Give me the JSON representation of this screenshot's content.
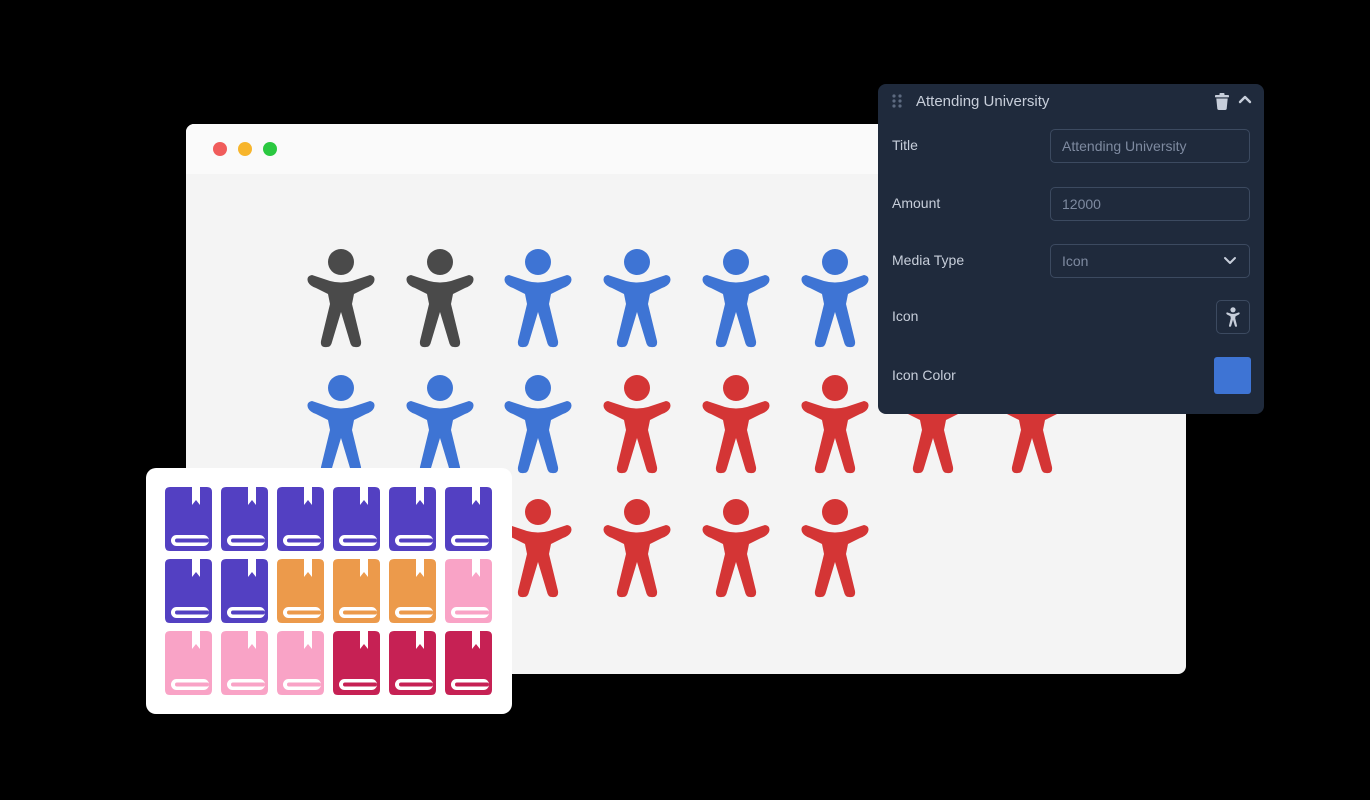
{
  "window": {
    "traffic_lights": [
      {
        "name": "close",
        "color": "#f05c5b"
      },
      {
        "name": "minimize",
        "color": "#f7b52c"
      },
      {
        "name": "maximize",
        "color": "#2ac840"
      }
    ]
  },
  "pictogram": {
    "icon": "person-icon",
    "colors": {
      "gray": "#4a4a4a",
      "blue": "#3e74d4",
      "red": "#d43535"
    },
    "rows": [
      [
        "gray",
        "gray",
        "blue",
        "blue",
        "blue",
        "blue",
        "blue",
        "blue"
      ],
      [
        "blue",
        "blue",
        "blue",
        "red",
        "red",
        "red",
        "red",
        "red"
      ],
      [
        "red",
        "red",
        "red",
        "red",
        "red",
        "red"
      ]
    ]
  },
  "book_card": {
    "icon": "book-icon",
    "colors": {
      "purple": "#5340c2",
      "orange": "#ec9a4b",
      "pink": "#f9a3c6",
      "crimson": "#c62154"
    },
    "rows": [
      [
        "purple",
        "purple",
        "purple",
        "purple",
        "purple",
        "purple"
      ],
      [
        "purple",
        "purple",
        "orange",
        "orange",
        "orange",
        "pink"
      ],
      [
        "pink",
        "pink",
        "pink",
        "crimson",
        "crimson",
        "crimson"
      ]
    ]
  },
  "panel": {
    "header_title": "Attending University",
    "fields": {
      "title": {
        "label": "Title",
        "value": "Attending University"
      },
      "amount": {
        "label": "Amount",
        "value": "12000"
      },
      "media_type": {
        "label": "Media Type",
        "value": "Icon"
      },
      "icon": {
        "label": "Icon",
        "value": "person-icon"
      },
      "icon_color": {
        "label": "Icon Color",
        "value": "#3e74d4"
      }
    }
  }
}
